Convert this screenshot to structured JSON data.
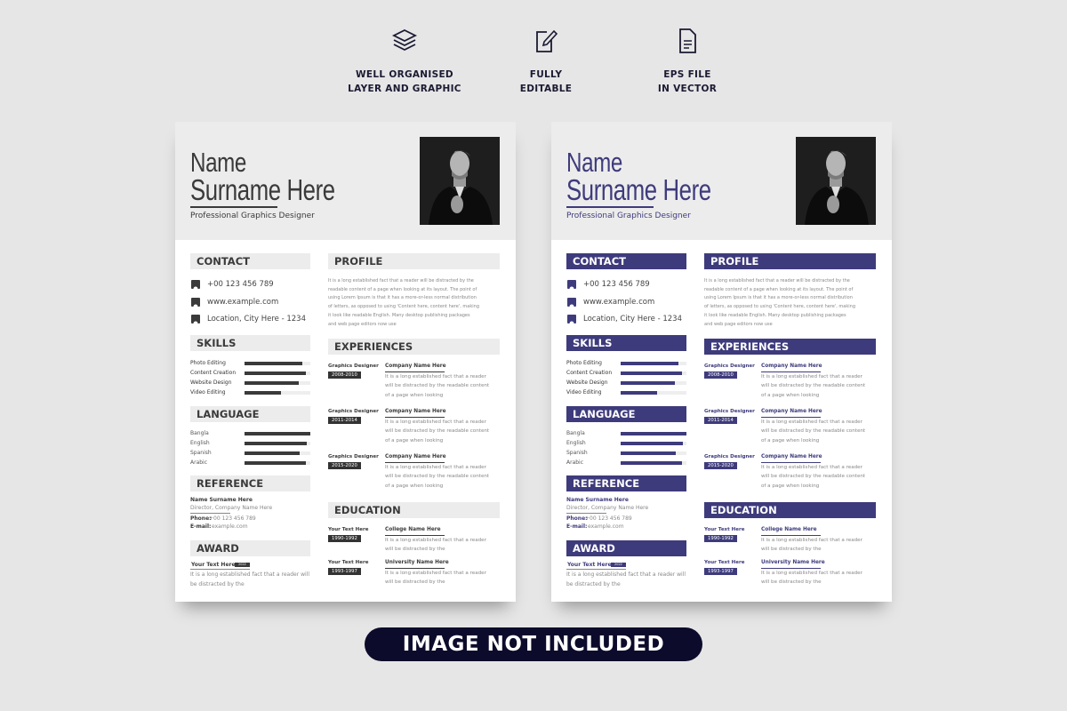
{
  "features": [
    {
      "icon": "layers-icon",
      "line1": "WELL ORGANISED",
      "line2": "LAYER AND GRAPHIC"
    },
    {
      "icon": "edit-icon",
      "line1": "FULLY",
      "line2": "EDITABLE"
    },
    {
      "icon": "document-icon",
      "line1": "EPS FILE",
      "line2": "IN VECTOR"
    }
  ],
  "resume": {
    "first_name": "Name",
    "last_name": "Surname Here",
    "title": "Professional Graphics Designer",
    "sections": {
      "contact": "CONTACT",
      "skills": "SKILLS",
      "language": "LANGUAGE",
      "reference": "REFERENCE",
      "award": "AWARD",
      "profile": "PROFILE",
      "experiences": "EXPERIENCES",
      "education": "EDUCATION"
    },
    "contact": [
      {
        "icon": "phone-icon",
        "text": "+00 123 456 789"
      },
      {
        "icon": "globe-icon",
        "text": "www.example.com"
      },
      {
        "icon": "location-icon",
        "text": "Location, City Here - 1234"
      }
    ],
    "skills": [
      {
        "label": "Photo Editing",
        "level": 0.88
      },
      {
        "label": "Content Creation",
        "level": 0.93
      },
      {
        "label": "Website Design",
        "level": 0.83
      },
      {
        "label": "Video Editing",
        "level": 0.55
      }
    ],
    "languages": [
      {
        "label": "Bangla",
        "level": 1.0
      },
      {
        "label": "English",
        "level": 0.95
      },
      {
        "label": "Spanish",
        "level": 0.84
      },
      {
        "label": "Arabic",
        "level": 0.93
      }
    ],
    "reference": {
      "name": "Name Surname Here",
      "role": "Director, Company Name Here",
      "phone_label": "Phone:",
      "phone": "+00 123 456 789",
      "email_label": "E-mail:",
      "email": "example.com"
    },
    "award": {
      "title": "Your Text Here",
      "year": "2022",
      "desc1": "It is a long established fact that a reader will",
      "desc2": "be distracted by the"
    },
    "profile": [
      "It is a long established fact that a reader will be distracted by the",
      "readable content of a page when looking at its layout. The point of",
      "using Lorem Ipsum is that it has a more-or-less normal distribution",
      "of letters, as opposed to using 'Content here, content here', making",
      "it look like readable English. Many desktop publishing packages",
      "and web page editors now use"
    ],
    "experiences": [
      {
        "role": "Graphics Designer",
        "years": "2008-2010",
        "company": "Company Name Here",
        "desc": [
          "It is a long established fact that a reader",
          "will be distracted by the readable content",
          "of a page when looking"
        ]
      },
      {
        "role": "Graphics Designer",
        "years": "2011-2014",
        "company": "Company Name Here",
        "desc": [
          "It is a long established fact that a reader",
          "will be distracted by the readable content",
          "of a page when looking"
        ]
      },
      {
        "role": "Graphics Designer",
        "years": "2015-2020",
        "company": "Company Name Here",
        "desc": [
          "It is a long established fact that a reader",
          "will be distracted by the readable content",
          "of a page when looking"
        ]
      }
    ],
    "education": [
      {
        "label": "Your Text Here",
        "years": "1990-1992",
        "school": "College Name Here",
        "desc": [
          "It is a long established fact that a reader",
          "will be distracted by the"
        ]
      },
      {
        "label": "Your Text Here",
        "years": "1993-1997",
        "school": "University Name Here",
        "desc": [
          "It is a long established fact that a reader",
          "will be distracted by the"
        ]
      }
    ]
  },
  "variants": [
    {
      "name": "gray",
      "accent": "#3a3a3a",
      "header_bg": "#ececec",
      "header_text": "#3a3a3a"
    },
    {
      "name": "purple",
      "accent": "#3e3b7c",
      "header_bg": "#3e3b7c",
      "header_text": "#ffffff"
    }
  ],
  "banner": "IMAGE NOT INCLUDED"
}
